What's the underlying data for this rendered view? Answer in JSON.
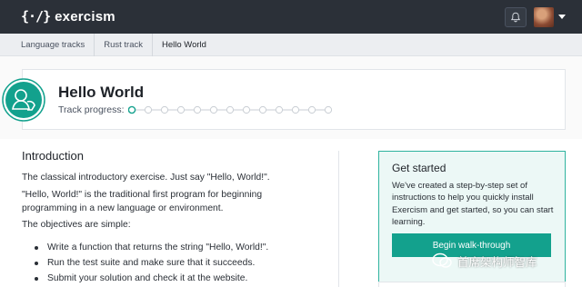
{
  "topbar": {
    "logo_mark": "{·/}",
    "logo_text": "exercism",
    "bell_icon": "bell-icon",
    "caret_icon": "chevron-down-icon"
  },
  "breadcrumb": {
    "items": [
      "Language tracks",
      "Rust track",
      "Hello World"
    ]
  },
  "exercise": {
    "title": "Hello World",
    "progress_label": "Track progress:",
    "progress": {
      "completed": 1,
      "total": 13
    }
  },
  "intro": {
    "heading": "Introduction",
    "paragraphs": [
      "The classical introductory exercise. Just say \"Hello, World!\".",
      "\"Hello, World!\" is the traditional first program for beginning programming in a new language or environment.",
      "The objectives are simple:"
    ],
    "objectives": [
      "Write a function that returns the string \"Hello, World!\".",
      "Run the test suite and make sure that it succeeds.",
      "Submit your solution and check it at the website."
    ]
  },
  "get_started": {
    "title": "Get started",
    "text": "We've created a step-by-step set of instructions to help you quickly install Exercism and get started, so you can start learning.",
    "button_label": "Begin walk-through"
  },
  "watermark": {
    "text": "首席架构师智库"
  },
  "colors": {
    "topbar": "#2b3038",
    "accent": "#13a18d",
    "accent_border": "#2fb39f",
    "card_tint": "#ecf8f6"
  }
}
